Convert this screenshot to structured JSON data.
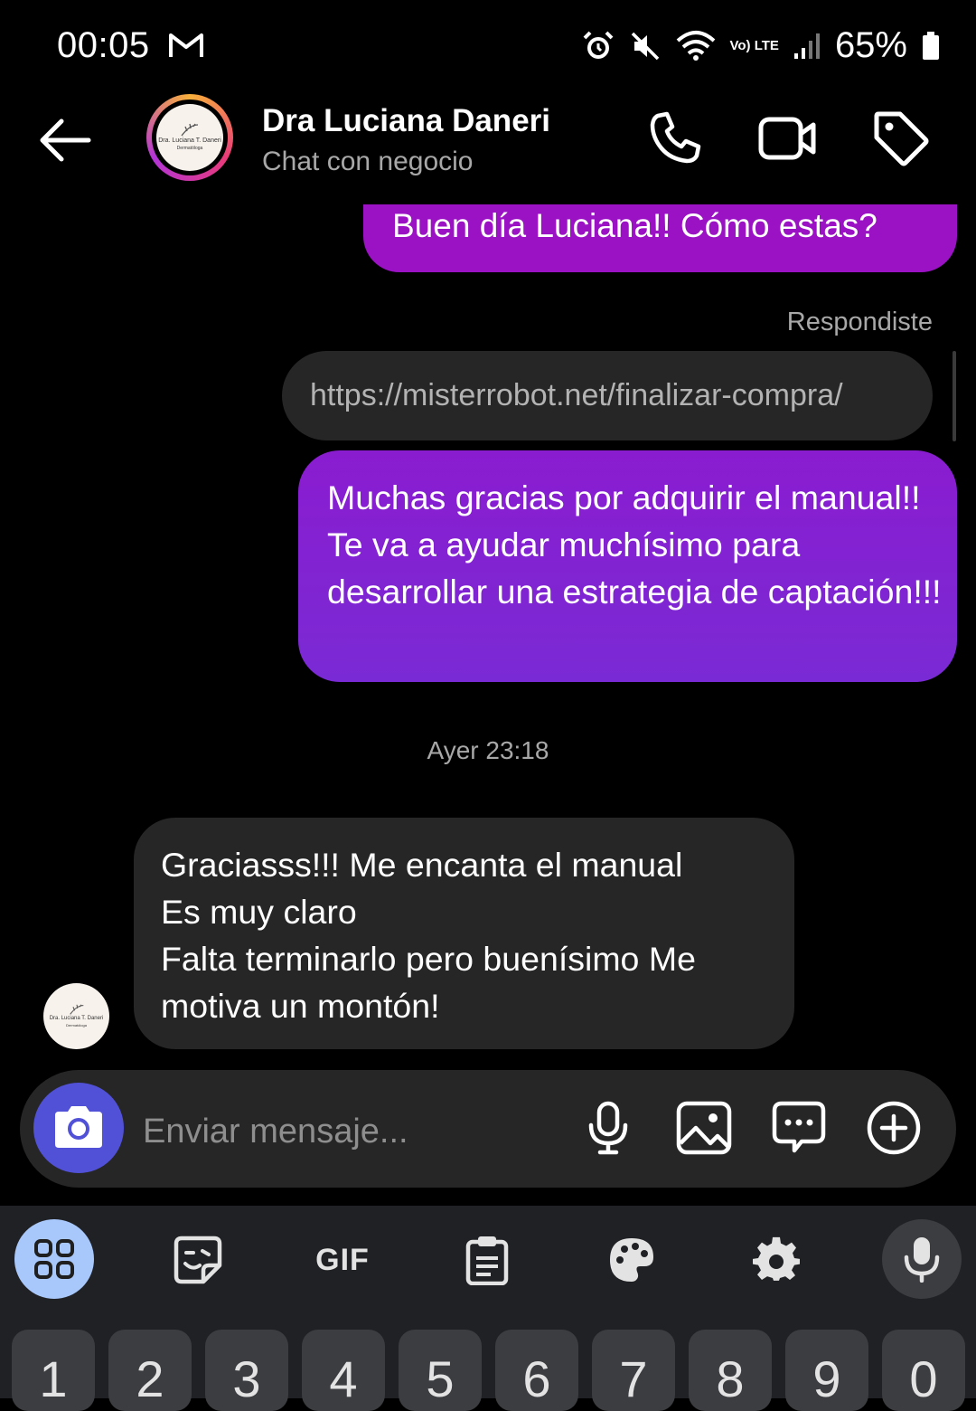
{
  "status_bar": {
    "time": "00:05",
    "battery": "65%",
    "network_label": "Vo) LTE",
    "icons": [
      "gmail-icon",
      "alarm-icon",
      "mute-icon",
      "wifi-icon",
      "volte-icon",
      "signal-icon",
      "battery-icon"
    ]
  },
  "header": {
    "contact_name": "Dra Luciana Daneri",
    "subtitle": "Chat con negocio",
    "avatar_text": "Dra. Luciana T. Daneri",
    "avatar_subtext": "Dermatóloga",
    "actions": [
      "phone-icon",
      "video-call-icon",
      "tag-icon"
    ]
  },
  "messages": {
    "m1": "Buen día Luciana!! Cómo estas?",
    "replied_label": "Respondiste",
    "reply_quote": "https://misterrobot.net/finalizar-compra/",
    "m2": "Muchas gracias por adquirir el manual!! Te va a ayudar muchísimo para desarrollar una estrategia de captación!!!",
    "timestamp": "Ayer 23:18",
    "m3_lines": [
      "Graciasss!!! Me encanta el manual",
      "Es muy claro",
      "Falta terminarlo pero buenísimo Me",
      "motiva un montón!"
    ]
  },
  "composer": {
    "placeholder": "Enviar mensaje...",
    "icons": [
      "camera-icon",
      "microphone-icon",
      "gallery-icon",
      "sticker-chat-icon",
      "add-icon"
    ]
  },
  "keyboard": {
    "toolbar": [
      "apps-grid-icon",
      "sticker-icon",
      "gif-icon",
      "clipboard-icon",
      "palette-icon",
      "settings-icon",
      "voice-input-icon"
    ],
    "gif_label": "GIF",
    "number_row": [
      "1",
      "2",
      "3",
      "4",
      "5",
      "6",
      "7",
      "8",
      "9",
      "0"
    ]
  },
  "colors": {
    "outgoing_bubble": "#9a12c4",
    "outgoing_bubble_2": "#8a1cd0",
    "incoming_bubble": "#262626",
    "camera_button": "#5151d8",
    "keyboard_bg": "#202124",
    "keyboard_accent": "#a8c7fa"
  }
}
